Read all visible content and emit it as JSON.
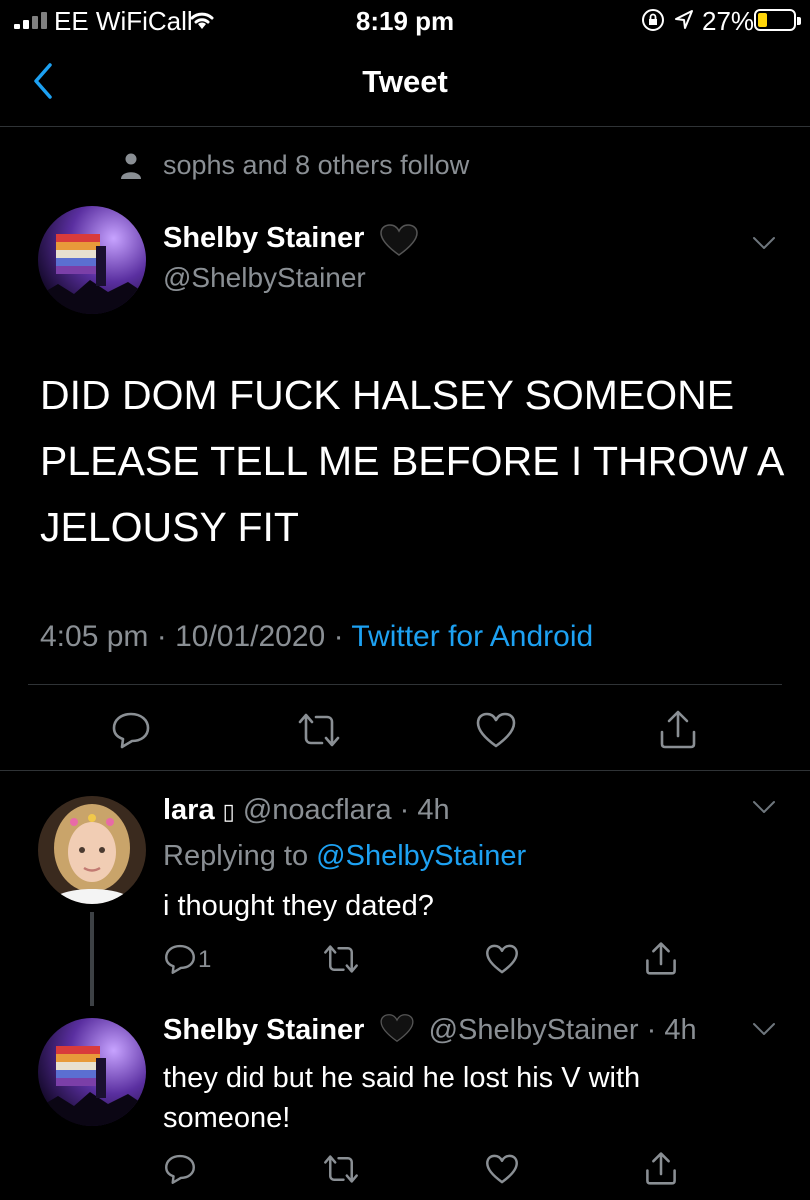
{
  "status_bar": {
    "carrier": "EE WiFiCall",
    "time": "8:19 pm",
    "battery": "27%",
    "battery_level": 0.27
  },
  "nav": {
    "title": "Tweet"
  },
  "context": {
    "followed_by": "sophs and 8 others follow"
  },
  "main_tweet": {
    "author_name": "Shelby Stainer",
    "author_handle": "@ShelbyStainer",
    "lines": [
      "DID DOM FUCK HALSEY SOMEONE",
      "PLEASE TELL ME BEFORE I THROW A",
      "JELOUSY FIT"
    ],
    "time": "4:05 pm",
    "date": "10/01/2020",
    "source": "Twitter for Android",
    "separator": "·"
  },
  "replies": [
    {
      "author_name": "lara",
      "name_glyph": "▯",
      "author_handle": "@noacflara",
      "age": "4h",
      "replying_prefix": "Replying to",
      "replying_to": "@ShelbyStainer",
      "text": "i thought they dated?",
      "reply_count": "1"
    },
    {
      "author_name": "Shelby Stainer",
      "author_handle": "@ShelbyStainer",
      "age": "4h",
      "text_lines": [
        "they did but he said he lost his V with",
        "someone!"
      ]
    }
  ],
  "colors": {
    "accent": "#1da1f2",
    "muted": "#8a8f94",
    "background": "#000000",
    "battery": "#ffd60a"
  },
  "icons": [
    "back-chevron-icon",
    "person-icon",
    "black-heart-icon",
    "chevron-down-icon",
    "reply-icon",
    "retweet-icon",
    "like-icon",
    "share-icon"
  ]
}
